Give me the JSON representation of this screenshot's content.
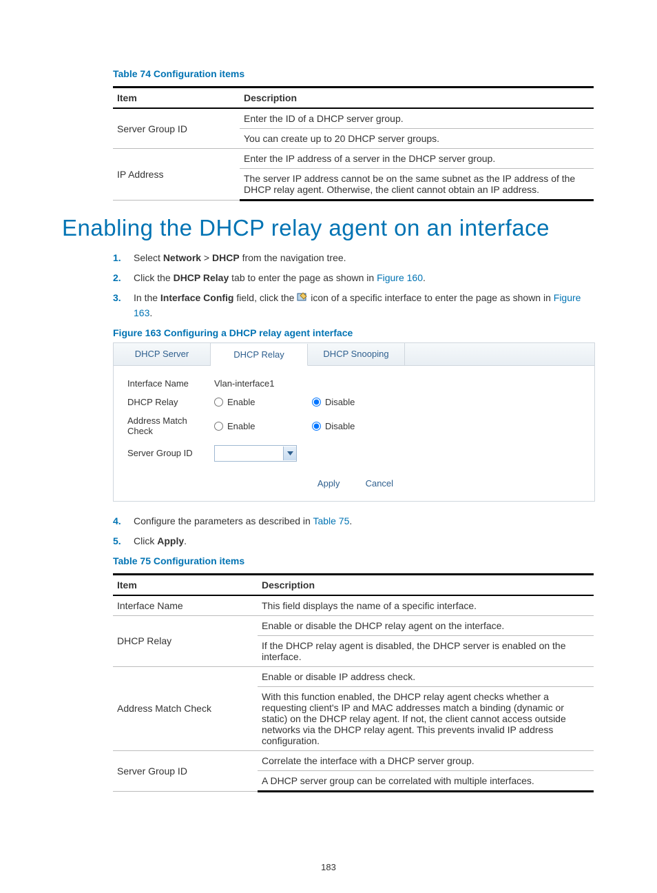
{
  "table74": {
    "caption": "Table 74 Configuration items",
    "head": {
      "item": "Item",
      "desc": "Description"
    },
    "rows": [
      {
        "item": "Server Group ID",
        "d1": "Enter the ID of a DHCP server group.",
        "d2": "You can create up to 20 DHCP server groups."
      },
      {
        "item": "IP Address",
        "d1": "Enter the IP address of a server in the DHCP server group.",
        "d2": "The server IP address cannot be on the same subnet as the IP address of the DHCP relay agent. Otherwise, the client cannot obtain an IP address."
      }
    ]
  },
  "heading": "Enabling the DHCP relay agent on an interface",
  "steps1": {
    "s1_a": "Select ",
    "s1_b": "Network",
    "s1_c": " > ",
    "s1_d": "DHCP",
    "s1_e": " from the navigation tree.",
    "s2_a": "Click the ",
    "s2_b": "DHCP Relay",
    "s2_c": " tab to enter the page as shown in ",
    "s2_link": "Figure 160",
    "s2_d": ".",
    "s3_a": "In the ",
    "s3_b": "Interface Config",
    "s3_c": " field, click the ",
    "s3_d": " icon of a specific interface to enter the page as shown in ",
    "s3_link": "Figure 163",
    "s3_e": "."
  },
  "figure163": {
    "caption": "Figure 163 Configuring a DHCP relay agent interface",
    "tabs": {
      "server": "DHCP Server",
      "relay": "DHCP Relay",
      "snooping": "DHCP Snooping"
    },
    "labels": {
      "interface_name": "Interface Name",
      "dhcp_relay": "DHCP Relay",
      "addr_match": "Address Match Check",
      "server_group": "Server Group ID"
    },
    "values": {
      "interface_name": "Vlan-interface1"
    },
    "options": {
      "enable": "Enable",
      "disable": "Disable"
    },
    "buttons": {
      "apply": "Apply",
      "cancel": "Cancel"
    }
  },
  "steps2": {
    "s4_a": "Configure the parameters as described in ",
    "s4_link": "Table 75",
    "s4_b": ".",
    "s5_a": "Click ",
    "s5_b": "Apply",
    "s5_c": "."
  },
  "table75": {
    "caption": "Table 75 Configuration items",
    "head": {
      "item": "Item",
      "desc": "Description"
    },
    "rows": {
      "r1": {
        "item": "Interface Name",
        "d1": "This field displays the name of a specific interface."
      },
      "r2": {
        "item": "DHCP Relay",
        "d1": "Enable or disable the DHCP relay agent on the interface.",
        "d2": "If the DHCP relay agent is disabled, the DHCP server is enabled on the interface."
      },
      "r3": {
        "item": "Address Match Check",
        "d1": "Enable or disable IP address check.",
        "d2": "With this function enabled, the DHCP relay agent checks whether a requesting client's IP and MAC addresses match a binding (dynamic or static) on the DHCP relay agent. If not, the client cannot access outside networks via the DHCP relay agent. This prevents invalid IP address configuration."
      },
      "r4": {
        "item": "Server Group ID",
        "d1": "Correlate the interface with a DHCP server group.",
        "d2": "A DHCP server group can be correlated with multiple interfaces."
      }
    }
  },
  "page_number": "183"
}
